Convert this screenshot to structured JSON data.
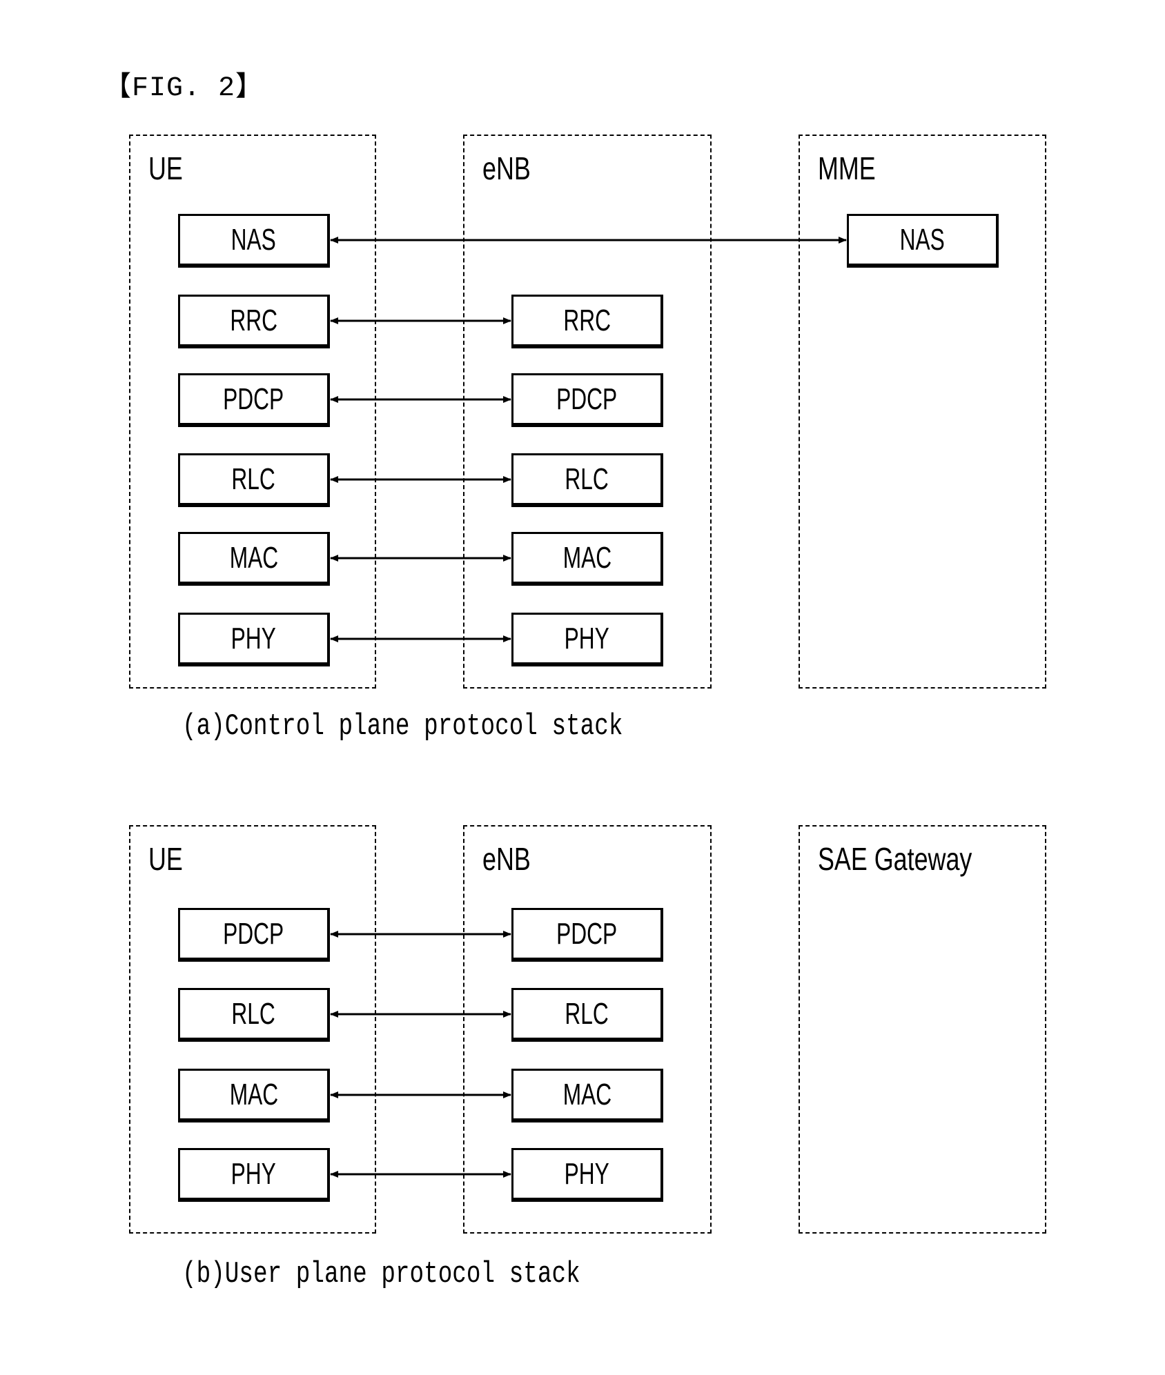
{
  "figure_title": "【FIG. 2】",
  "control_plane": {
    "caption": "(a)Control plane protocol stack",
    "entities": {
      "ue": {
        "label": "UE",
        "layers": [
          "NAS",
          "RRC",
          "PDCP",
          "RLC",
          "MAC",
          "PHY"
        ]
      },
      "enb": {
        "label": "eNB",
        "layers": [
          "RRC",
          "PDCP",
          "RLC",
          "MAC",
          "PHY"
        ]
      },
      "mme": {
        "label": "MME",
        "layers": [
          "NAS"
        ]
      }
    },
    "links": [
      {
        "from": "UE.NAS",
        "to": "MME.NAS"
      },
      {
        "from": "UE.RRC",
        "to": "eNB.RRC"
      },
      {
        "from": "UE.PDCP",
        "to": "eNB.PDCP"
      },
      {
        "from": "UE.RLC",
        "to": "eNB.RLC"
      },
      {
        "from": "UE.MAC",
        "to": "eNB.MAC"
      },
      {
        "from": "UE.PHY",
        "to": "eNB.PHY"
      }
    ]
  },
  "user_plane": {
    "caption": "(b)User plane protocol stack",
    "entities": {
      "ue": {
        "label": "UE",
        "layers": [
          "PDCP",
          "RLC",
          "MAC",
          "PHY"
        ]
      },
      "enb": {
        "label": "eNB",
        "layers": [
          "PDCP",
          "RLC",
          "MAC",
          "PHY"
        ]
      },
      "gw": {
        "label": "SAE Gateway",
        "layers": []
      }
    },
    "links": [
      {
        "from": "UE.PDCP",
        "to": "eNB.PDCP"
      },
      {
        "from": "UE.RLC",
        "to": "eNB.RLC"
      },
      {
        "from": "UE.MAC",
        "to": "eNB.MAC"
      },
      {
        "from": "UE.PHY",
        "to": "eNB.PHY"
      }
    ]
  }
}
